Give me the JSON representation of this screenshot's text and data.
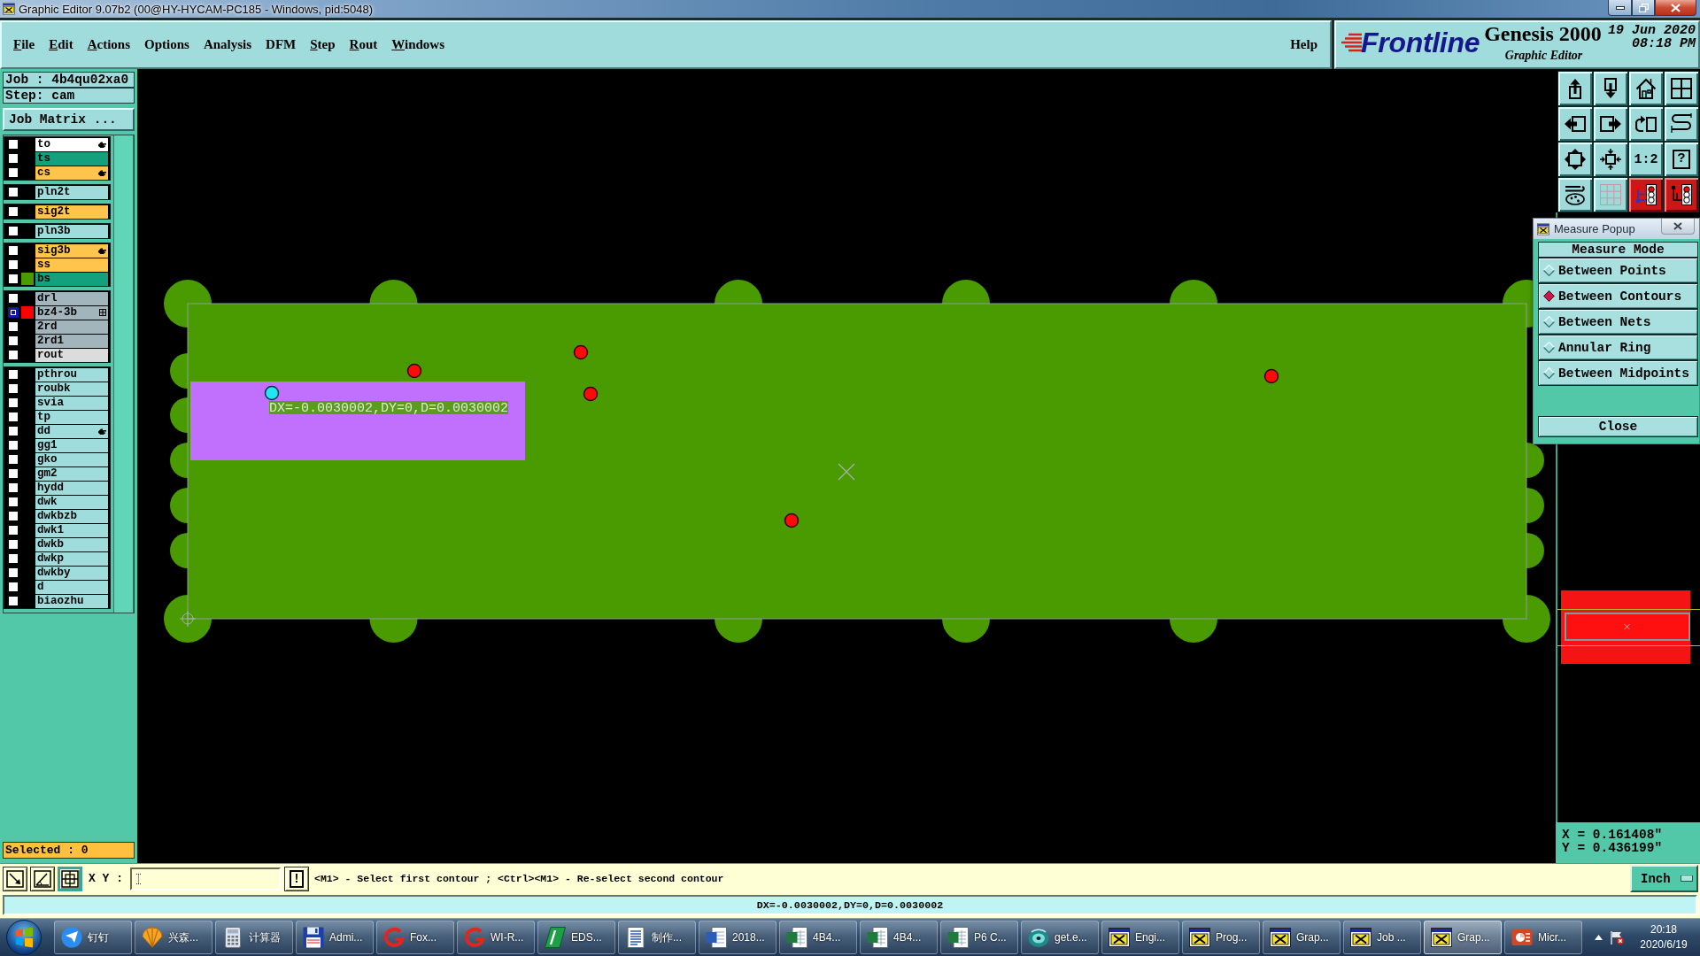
{
  "window": {
    "title": "Graphic Editor 9.07b2 (00@HY-HYCAM-PC185 - Windows, pid:5048)"
  },
  "menu": {
    "items": [
      {
        "label": "File",
        "underlined": true
      },
      {
        "label": "Edit",
        "underlined": true
      },
      {
        "label": "Actions",
        "underlined": true
      },
      {
        "label": "Options",
        "underlined": false
      },
      {
        "label": "Analysis",
        "underlined": false
      },
      {
        "label": "DFM",
        "underlined": false
      },
      {
        "label": "Step",
        "underlined": true
      },
      {
        "label": "Rout",
        "underlined": true
      },
      {
        "label": "Windows",
        "underlined": true
      }
    ],
    "help": {
      "label": "Help",
      "underlined": false
    }
  },
  "logo": {
    "brand": "Frontline",
    "product": "Genesis 2000",
    "subtitle": "Graphic Editor",
    "date": "19 Jun 2020",
    "time": "08:18 PM"
  },
  "job_panel": {
    "job": "Job : 4b4qu02xa0",
    "step": "Step: cam",
    "matrix_button": "Job Matrix ...",
    "selected_count": "Selected : 0"
  },
  "layer_groups": [
    {
      "layers": [
        {
          "name": "to",
          "kind": "silk_screen",
          "checked": false,
          "marker": {
            "kind": "hand"
          }
        },
        {
          "name": "ts",
          "kind": "solder_mask",
          "checked": false
        },
        {
          "name": "cs",
          "kind": "signal",
          "checked": false,
          "marker": {
            "kind": "hand"
          }
        }
      ]
    },
    {
      "layers": [
        {
          "name": "pln2t",
          "kind": "misc",
          "checked": false
        }
      ]
    },
    {
      "layers": [
        {
          "name": "sig2t",
          "kind": "signal",
          "checked": false
        }
      ]
    },
    {
      "layers": [
        {
          "name": "pln3b",
          "kind": "misc",
          "checked": false
        }
      ]
    },
    {
      "layers": [
        {
          "name": "sig3b",
          "kind": "signal",
          "checked": false,
          "marker": {
            "kind": "hand"
          }
        },
        {
          "name": "ss",
          "kind": "signal",
          "checked": false
        },
        {
          "name": "bs",
          "kind": "solder_mask",
          "checked": false,
          "color": "#4a9a02"
        }
      ]
    },
    {
      "layers": [
        {
          "name": "drl",
          "kind": "drill",
          "checked": false
        },
        {
          "name": "bz4-3b",
          "kind": "drill",
          "checked": true,
          "color": "#ff0000",
          "marker": {
            "kind": "grid"
          }
        },
        {
          "name": "2rd",
          "kind": "drill",
          "checked": false
        },
        {
          "name": "2rd1",
          "kind": "drill",
          "checked": false
        },
        {
          "name": "rout",
          "kind": "rout",
          "checked": false
        }
      ]
    },
    {
      "layers": [
        {
          "name": "pthrou",
          "kind": "misc",
          "checked": false
        },
        {
          "name": "roubk",
          "kind": "misc",
          "checked": false
        },
        {
          "name": "svia",
          "kind": "misc",
          "checked": false
        },
        {
          "name": "tp",
          "kind": "misc",
          "checked": false
        },
        {
          "name": "dd",
          "kind": "misc",
          "checked": false,
          "marker": {
            "kind": "hand"
          }
        },
        {
          "name": "gg1",
          "kind": "misc",
          "checked": false
        },
        {
          "name": "gko",
          "kind": "misc",
          "checked": false
        },
        {
          "name": "gm2",
          "kind": "misc",
          "checked": false
        },
        {
          "name": "hydd",
          "kind": "misc",
          "checked": false
        },
        {
          "name": "dwk",
          "kind": "misc",
          "checked": false
        },
        {
          "name": "dwkbzb",
          "kind": "misc",
          "checked": false
        },
        {
          "name": "dwk1",
          "kind": "misc",
          "checked": false
        },
        {
          "name": "dwkb",
          "kind": "misc",
          "checked": false
        },
        {
          "name": "dwkp",
          "kind": "misc",
          "checked": false
        },
        {
          "name": "dwkby",
          "kind": "misc",
          "checked": false
        },
        {
          "name": "d",
          "kind": "misc",
          "checked": false
        },
        {
          "name": "biaozhu",
          "kind": "misc",
          "checked": false
        }
      ]
    }
  ],
  "canvas": {
    "measure_label": "DX=-0.0030002,DY=0,D=0.0030002"
  },
  "toolbar": {
    "buttons": [
      {
        "on": false
      },
      {
        "on": false
      },
      {
        "on": false
      },
      {
        "on": false
      },
      {
        "on": false
      },
      {
        "on": false
      },
      {
        "on": false
      },
      {
        "on": false
      },
      {
        "on": false
      },
      {
        "on": false
      },
      {
        "label": "1:2",
        "on": false
      },
      {
        "label": "?",
        "on": false
      },
      {
        "on": false
      },
      {
        "on": false
      },
      {
        "on": true
      },
      {
        "on": true
      }
    ]
  },
  "measure_popup": {
    "title": "Measure Popup",
    "header": "Measure Mode",
    "modes": [
      {
        "label": "Between Points",
        "selected": false
      },
      {
        "label": "Between Contours",
        "selected": true
      },
      {
        "label": "Between Nets",
        "selected": false
      },
      {
        "label": "Annular Ring",
        "selected": false
      },
      {
        "label": "Between Midpoints",
        "selected": false
      }
    ],
    "close": "Close"
  },
  "coordinates": {
    "x": "X = 0.161408\"",
    "y": "Y = 0.436199\""
  },
  "command_line": {
    "tools": [
      {
        "on": false
      },
      {
        "on": false
      },
      {
        "on": true
      }
    ],
    "label": "X Y :",
    "execute": "!",
    "prompt": "<M1> - Select first contour ; <Ctrl><M1> - Re-select second contour",
    "units": "Inch"
  },
  "status_line": {
    "message": "DX=-0.0030002,DY=0,D=0.0030002"
  },
  "taskbar": {
    "items": [
      {
        "label": "钉钉",
        "kind": "paper_plane",
        "selected": false
      },
      {
        "label": "兴森...",
        "kind": "shell",
        "selected": false
      },
      {
        "label": "计算器",
        "kind": "calculator",
        "selected": false
      },
      {
        "label": "Admi...",
        "kind": "floppy",
        "selected": false
      },
      {
        "label": "Fox...",
        "kind": "swirl",
        "selected": false
      },
      {
        "label": "WI-R...",
        "kind": "swirl",
        "selected": false
      },
      {
        "label": "EDS...",
        "kind": "badge",
        "selected": false
      },
      {
        "label": "制作...",
        "kind": "document",
        "selected": false
      },
      {
        "label": "2018...",
        "kind": "word_doc",
        "selected": false
      },
      {
        "label": "4B4...",
        "kind": "spreadsheet",
        "selected": false
      },
      {
        "label": "4B4...",
        "kind": "spreadsheet",
        "selected": false
      },
      {
        "label": "P6 C...",
        "kind": "spreadsheet",
        "selected": false
      },
      {
        "label": "get.e...",
        "kind": "disc",
        "selected": false
      },
      {
        "label": "Engi...",
        "kind": "x_window",
        "selected": false
      },
      {
        "label": "Prog...",
        "kind": "x_window",
        "selected": false
      },
      {
        "label": "Grap...",
        "kind": "x_window",
        "selected": false
      },
      {
        "label": "Job ...",
        "kind": "x_window",
        "selected": false
      },
      {
        "label": "Grap...",
        "kind": "x_window",
        "selected": true
      },
      {
        "label": "Micr...",
        "kind": "slides",
        "selected": false
      }
    ],
    "clock": {
      "time": "20:18",
      "date": "2020/6/19"
    }
  }
}
